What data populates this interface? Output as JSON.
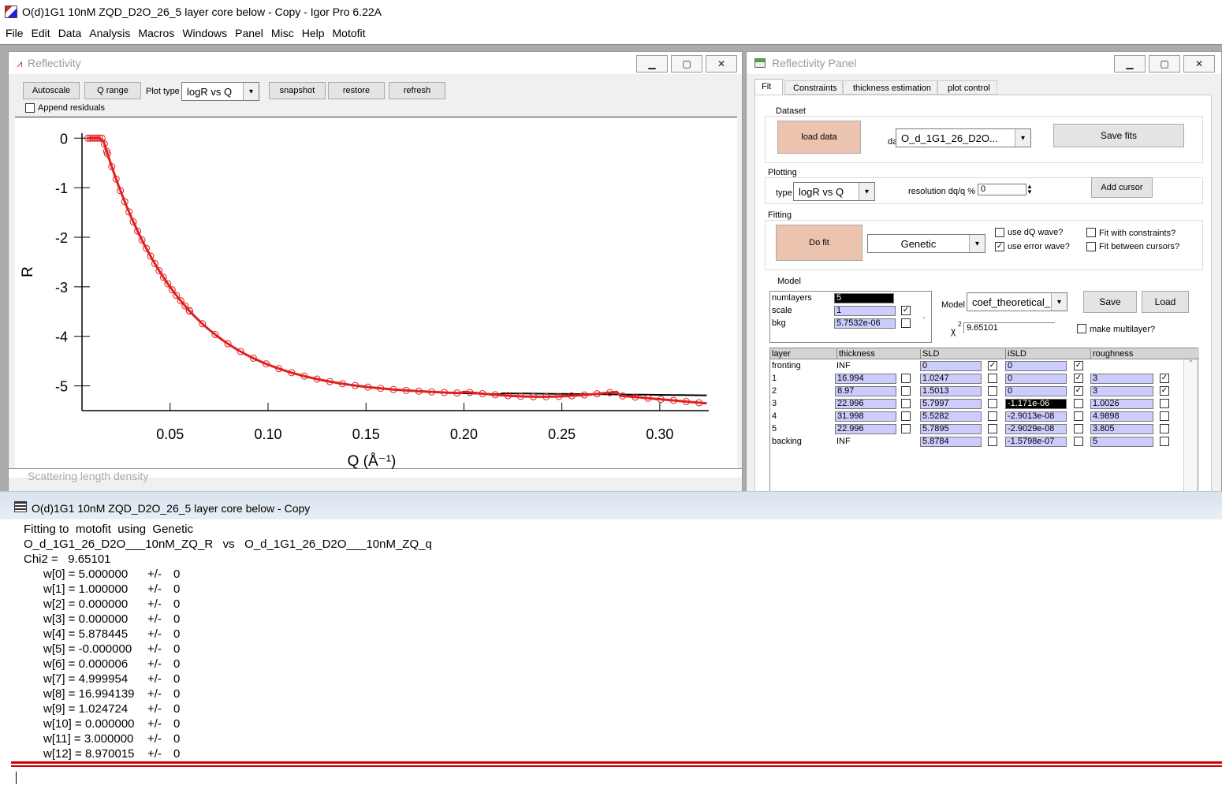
{
  "app": {
    "title": "O(d)1G1 10nM ZQD_D2O_26_5 layer core below - Copy - Igor Pro 6.22A"
  },
  "menu": [
    "File",
    "Edit",
    "Data",
    "Analysis",
    "Macros",
    "Windows",
    "Panel",
    "Misc",
    "Help",
    "Motofit"
  ],
  "graphwin": {
    "title": "Reflectivity",
    "autoscale": "Autoscale",
    "qrange": "Q range",
    "plottype_label": "Plot type",
    "plottype_value": "logR vs Q",
    "snapshot": "snapshot",
    "restore": "restore",
    "refresh": "refresh",
    "append_residuals": "Append residuals",
    "behind_title": "Scattering length density"
  },
  "chart_data": {
    "type": "scatter",
    "xlabel": "Q (Å⁻¹)",
    "ylabel": "R",
    "xlim": [
      0.005,
      0.325
    ],
    "ylim": [
      -5.5,
      0.1
    ],
    "xticks": [
      "0.05",
      "0.10",
      "0.15",
      "0.20",
      "0.25",
      "0.30"
    ],
    "xtickvals": [
      0.05,
      0.1,
      0.15,
      0.2,
      0.25,
      0.3
    ],
    "yticks": [
      "0",
      "-1",
      "-2",
      "-3",
      "-4",
      "-5"
    ],
    "ytickvals": [
      0,
      -1,
      -2,
      -3,
      -4,
      -5
    ],
    "series": [
      {
        "style": "data",
        "color": "#e02020"
      },
      {
        "style": "fit",
        "color": "#000000"
      }
    ]
  },
  "panel": {
    "title": "Reflectivity Panel",
    "tabs": [
      "Fit",
      "Constraints",
      "thickness estimation",
      "plot control"
    ],
    "dataset_group": "Dataset",
    "load_data": "load data",
    "dataset_label": "dataset",
    "dataset_value": "O_d_1G1_26_D2O...",
    "save_fits": "Save fits",
    "plotting_group": "Plotting",
    "type_label": "type",
    "type_value": "logR vs Q",
    "res_label": "resolution dq/q %",
    "res_value": "0",
    "add_cursor": "Add cursor",
    "fitting_group": "Fitting",
    "do_fit": "Do fit",
    "method": "Genetic",
    "use_dq": "use dQ wave?",
    "use_err": "use error wave?",
    "fit_constraints": "Fit with constraints?",
    "fit_cursors": "Fit between cursors?",
    "model_group": "Model",
    "numlayers_label": "numlayers",
    "numlayers": "5",
    "scale_label": "scale",
    "scale": "1",
    "bkg_label": "bkg",
    "bkg": "5.7532e-06",
    "model_label": "Model",
    "model_value": "coef_theoretical_R",
    "save": "Save",
    "load": "Load",
    "chi_label": "χ",
    "chi_sup": "2",
    "chi_value": "9.65101",
    "make_multilayer": "make multilayer?",
    "headers": [
      "layer",
      "thickness",
      "SLD",
      "iSLD",
      "roughness"
    ],
    "rows": [
      {
        "layer": "fronting",
        "thickness": "INF",
        "sld": "0",
        "isld": "0",
        "rough": "",
        "c": [
          false,
          true,
          true,
          false
        ],
        "dark": false,
        "roughHidden": true
      },
      {
        "layer": "1",
        "thickness": "16.994",
        "sld": "1.0247",
        "isld": "0",
        "rough": "3",
        "c": [
          false,
          false,
          true,
          true
        ]
      },
      {
        "layer": "2",
        "thickness": "8.97",
        "sld": "1.5013",
        "isld": "0",
        "rough": "3",
        "c": [
          false,
          false,
          true,
          true
        ]
      },
      {
        "layer": "3",
        "thickness": "22.996",
        "sld": "5.7997",
        "isld": "-1.171e-06",
        "rough": "1.0026",
        "c": [
          false,
          false,
          false,
          false
        ],
        "dark": true
      },
      {
        "layer": "4",
        "thickness": "31.998",
        "sld": "5.5282",
        "isld": "-2.9013e-08",
        "rough": "4.9898",
        "c": [
          false,
          false,
          false,
          false
        ]
      },
      {
        "layer": "5",
        "thickness": "22.996",
        "sld": "5.7895",
        "isld": "-2.9029e-08",
        "rough": "3.805",
        "c": [
          false,
          false,
          false,
          false
        ]
      },
      {
        "layer": "backing",
        "thickness": "INF",
        "sld": "5.8784",
        "isld": "-1.5798e-07",
        "rough": "5",
        "c": [
          false,
          false,
          false,
          false
        ]
      }
    ]
  },
  "history": {
    "title": "O(d)1G1 10nM ZQD_D2O_26_5 layer core below - Copy",
    "lines": [
      "Fitting to  motofit  using  Genetic",
      "O_d_1G1_26_D2O___10nM_ZQ_R   vs   O_d_1G1_26_D2O___10nM_ZQ_q",
      "Chi2 =   9.65101"
    ],
    "w": [
      [
        "w[0] = 5.000000",
        "+/-",
        "0"
      ],
      [
        "w[1] = 1.000000",
        "+/-",
        "0"
      ],
      [
        "w[2] = 0.000000",
        "+/-",
        "0"
      ],
      [
        "w[3] = 0.000000",
        "+/-",
        "0"
      ],
      [
        "w[4] = 5.878445",
        "+/-",
        "0"
      ],
      [
        "w[5] = -0.000000",
        "+/-",
        "0"
      ],
      [
        "w[6] = 0.000006",
        "+/-",
        "0"
      ],
      [
        "w[7] = 4.999954",
        "+/-",
        "0"
      ],
      [
        "w[8] = 16.994139",
        "+/-",
        "0"
      ],
      [
        "w[9] = 1.024724",
        "+/-",
        "0"
      ],
      [
        "w[10] = 0.000000",
        "+/-",
        "0"
      ],
      [
        "w[11] = 3.000000",
        "+/-",
        "0"
      ],
      [
        "w[12] = 8.970015",
        "+/-",
        "0"
      ]
    ]
  }
}
